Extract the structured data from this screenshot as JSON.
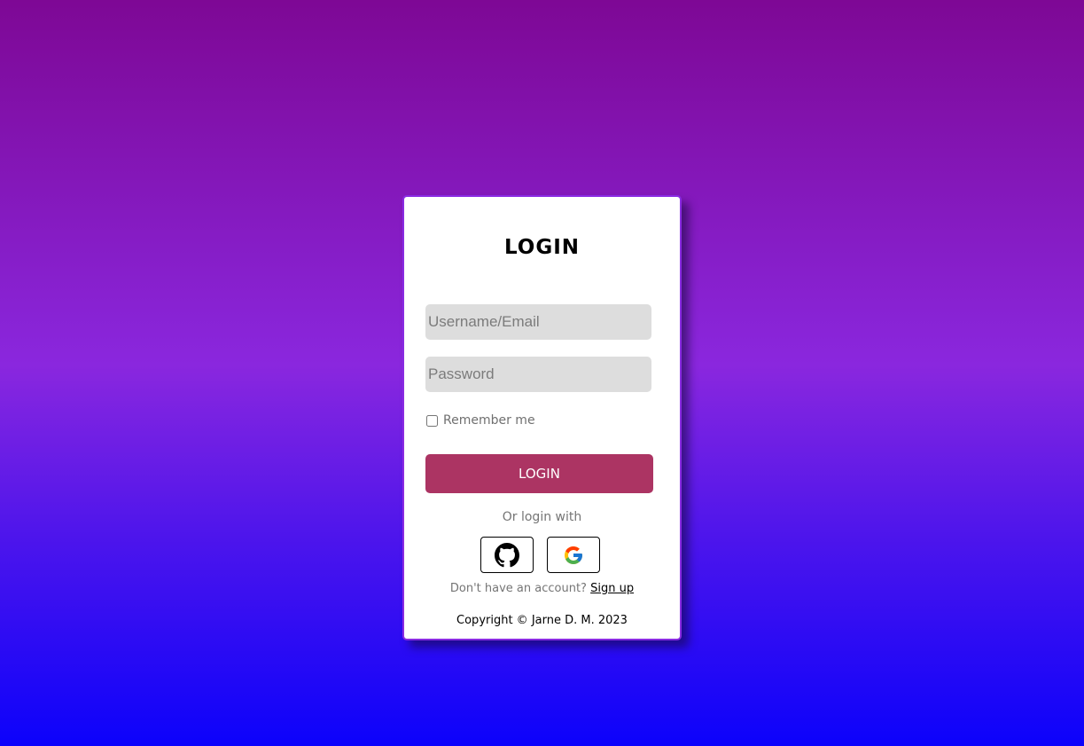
{
  "login_card": {
    "title": "LOGIN",
    "username_placeholder": "Username/Email",
    "password_placeholder": "Password",
    "remember_label": "Remember me",
    "remember_checked": false,
    "login_button_label": "LOGIN",
    "or_login_with": "Or login with",
    "social": [
      {
        "name": "github",
        "icon": "github-icon"
      },
      {
        "name": "google",
        "icon": "google-icon"
      }
    ],
    "signup_prompt": "Don't have an account?",
    "signup_link": "Sign up",
    "copyright": "Copyright © Jarne D. M. 2023"
  },
  "colors": {
    "background_top": "#7e0895",
    "background_mid": "#8a27de",
    "background_bottom": "#0c02fb",
    "card_border": "#8a2be2",
    "login_button": "#ac3463",
    "input_background": "#dddddd"
  }
}
